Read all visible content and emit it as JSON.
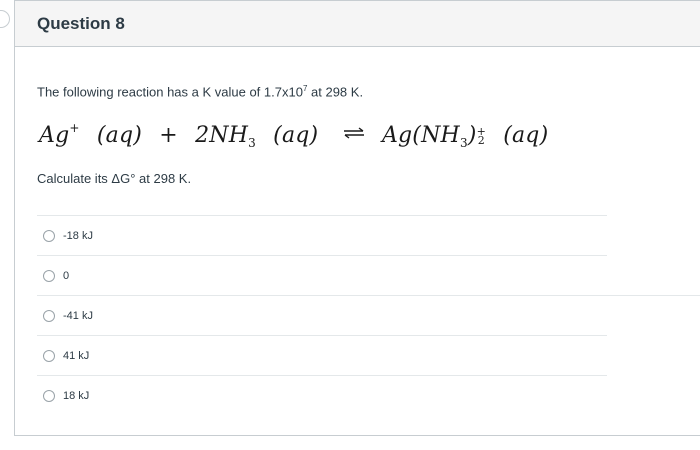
{
  "question": {
    "title": "Question 8",
    "text_prefix": "The following reaction has a K value of 1.7x10",
    "text_exponent": "7",
    "text_suffix": " at 298 K.",
    "equation": {
      "reactant1": "Ag",
      "reactant1_charge": "+",
      "reactant1_state": "(aq)",
      "plus": "+",
      "reactant2_coef": "2NH",
      "reactant2_sub": "3",
      "reactant2_state": "(aq)",
      "product_prefix": "Ag(NH",
      "product_sub": "3",
      "product_close": ")",
      "product_charge": "+",
      "product_count": "2",
      "product_state": "(aq)"
    },
    "prompt": "Calculate its ΔG° at 298 K.",
    "answers": [
      {
        "label": "-18 kJ"
      },
      {
        "label": "0"
      },
      {
        "label": "-41 kJ"
      },
      {
        "label": "41 kJ"
      },
      {
        "label": "18 kJ"
      }
    ]
  }
}
